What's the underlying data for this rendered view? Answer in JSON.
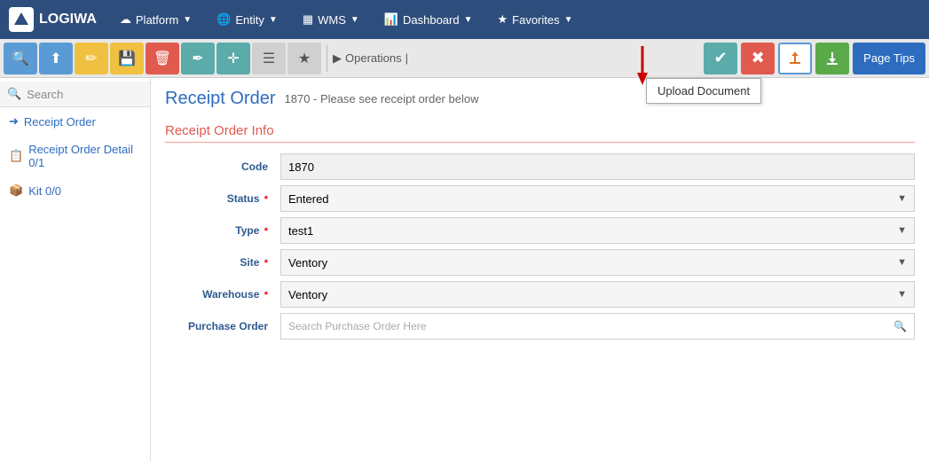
{
  "topnav": {
    "logo": "LOGIWA",
    "items": [
      {
        "label": "Platform",
        "icon": "cloud"
      },
      {
        "label": "Entity",
        "icon": "globe"
      },
      {
        "label": "WMS",
        "icon": "grid"
      },
      {
        "label": "Dashboard",
        "icon": "bar-chart"
      },
      {
        "label": "Favorites",
        "icon": "star"
      }
    ]
  },
  "toolbar": {
    "buttons": [
      {
        "id": "search",
        "icon": "🔍",
        "color": "blue"
      },
      {
        "id": "upload",
        "icon": "⬆",
        "color": "blue"
      },
      {
        "id": "edit",
        "icon": "✏",
        "color": "yellow"
      },
      {
        "id": "save",
        "icon": "💾",
        "color": "yellow"
      },
      {
        "id": "delete",
        "icon": "🗑",
        "color": "red-btn"
      },
      {
        "id": "pen",
        "icon": "✒",
        "color": "teal"
      },
      {
        "id": "move",
        "icon": "✛",
        "color": "teal"
      },
      {
        "id": "list",
        "icon": "☰",
        "color": "plain"
      },
      {
        "id": "star",
        "icon": "★",
        "color": "plain"
      }
    ],
    "breadcrumb": "Operations",
    "separator": "|",
    "action_check": "✔",
    "action_x": "✖",
    "action_upload_icon": "⬆",
    "action_download_icon": "⬇",
    "page_tips_label": "Page Tips"
  },
  "tooltip": {
    "text": "Upload Document"
  },
  "sidebar": {
    "search_placeholder": "Search",
    "items": [
      {
        "label": "Receipt Order",
        "icon": "📋"
      },
      {
        "label": "Receipt Order Detail 0/1",
        "icon": "📋"
      },
      {
        "label": "Kit 0/0",
        "icon": "📦"
      }
    ]
  },
  "main": {
    "title": "Receipt Order",
    "subtitle": "1870 - Please see receipt order below",
    "section": "Receipt Order Info",
    "form": {
      "fields": [
        {
          "label": "Code",
          "value": "1870",
          "type": "text",
          "required": false
        },
        {
          "label": "Status",
          "value": "Entered",
          "type": "select",
          "required": true
        },
        {
          "label": "Type",
          "value": "test1",
          "type": "select",
          "required": true
        },
        {
          "label": "Site",
          "value": "Ventory",
          "type": "select",
          "required": true
        },
        {
          "label": "Warehouse",
          "value": "Ventory",
          "type": "select",
          "required": true
        },
        {
          "label": "Purchase Order",
          "value": "",
          "placeholder": "Search Purchase Order Here",
          "type": "search",
          "required": false
        }
      ]
    }
  }
}
